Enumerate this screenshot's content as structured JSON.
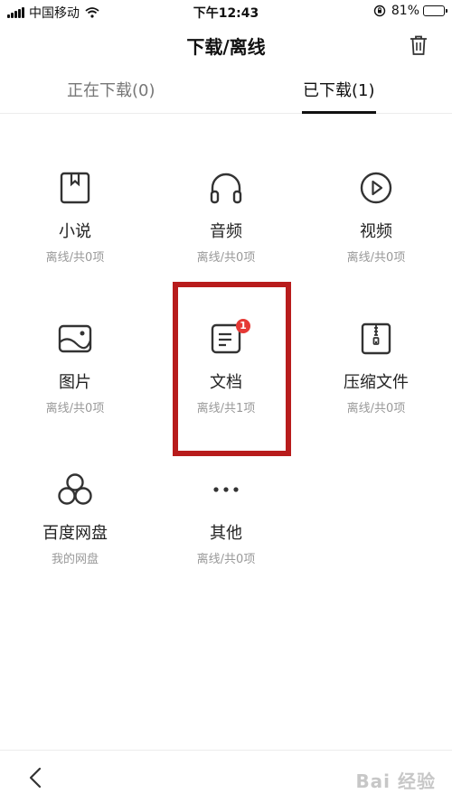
{
  "status_bar": {
    "carrier": "中国移动",
    "time": "下午12:43",
    "battery": "81%",
    "battery_level": 0.81
  },
  "header": {
    "title": "下载/离线"
  },
  "tabs": [
    {
      "label": "正在下载(0)",
      "active": false
    },
    {
      "label": "已下载(1)",
      "active": true
    }
  ],
  "categories": [
    {
      "label": "小说",
      "sub": "离线/共0项",
      "icon": "bookmark-book-icon"
    },
    {
      "label": "音频",
      "sub": "离线/共0项",
      "icon": "headphones-icon"
    },
    {
      "label": "视频",
      "sub": "离线/共0项",
      "icon": "play-circle-icon"
    },
    {
      "label": "图片",
      "sub": "离线/共0项",
      "icon": "image-icon"
    },
    {
      "label": "文档",
      "sub": "离线/共1项",
      "icon": "document-icon",
      "badge": "1"
    },
    {
      "label": "压缩文件",
      "sub": "离线/共0项",
      "icon": "zip-file-icon"
    },
    {
      "label": "百度网盘",
      "sub": "我的网盘",
      "icon": "baidu-cloud-icon"
    },
    {
      "label": "其他",
      "sub": "离线/共0项",
      "icon": "more-dots-icon"
    }
  ],
  "watermark": "Bai 经验",
  "colors": {
    "highlight": "#b81c1c",
    "badge": "#e53935"
  }
}
